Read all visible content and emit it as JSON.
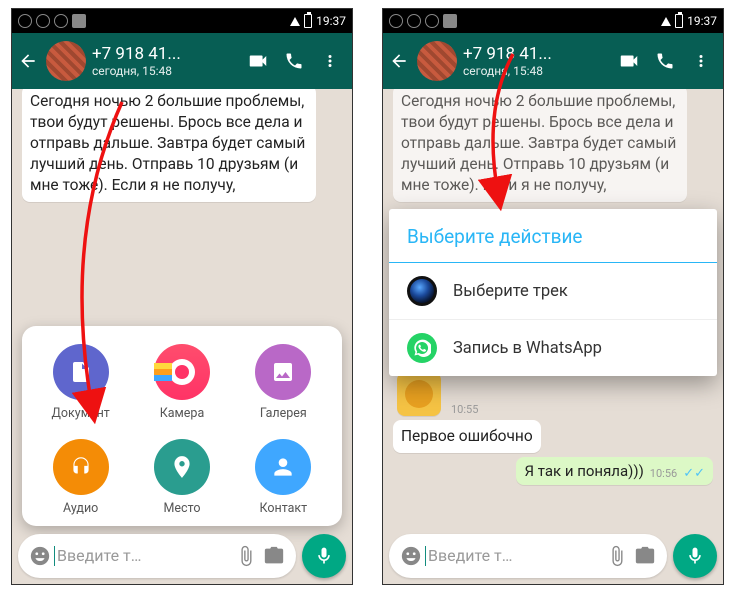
{
  "statusbar": {
    "time": "19:37"
  },
  "header": {
    "title": "+7 918 41...",
    "subtitle": "сегодня, 15:48"
  },
  "chat": {
    "incoming_text": "Сегодня ночью 2 большие проблемы, твои будут решены. Брось все дела и отправь дальше. Завтра будет самый лучший день. Отправь 10 друзьям (и мне тоже). Если я не получу,",
    "input_placeholder": "Введите т…"
  },
  "attach": {
    "doc": "Документ",
    "cam": "Камера",
    "gal": "Галерея",
    "aud": "Аудио",
    "loc": "Место",
    "con": "Контакт"
  },
  "dialog": {
    "title": "Выберите действие",
    "opt1": "Выберите трек",
    "opt2": "Запись в WhatsApp"
  },
  "right_chat": {
    "sticker_time": "10:55",
    "msg1": "Первое ошибочно",
    "msg2": "Я так и поняла)))",
    "msg2_time": "10:56"
  }
}
